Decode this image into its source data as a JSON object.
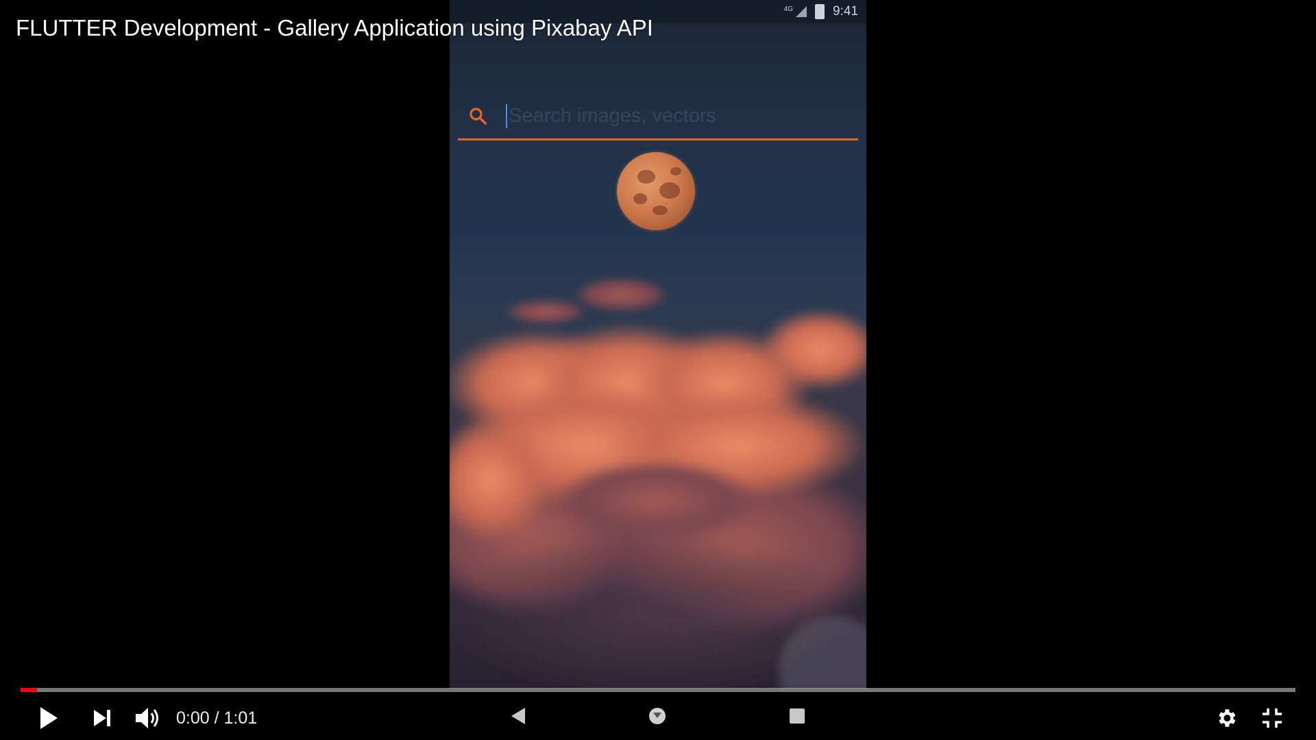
{
  "video": {
    "title": "FLUTTER Development - Gallery Application using Pixabay API"
  },
  "phone": {
    "status": {
      "network": "4G",
      "time": "9:41"
    },
    "search": {
      "placeholder": "Search images, vectors",
      "value": ""
    },
    "nav": {
      "back_icon": "back-icon",
      "home_icon": "home-icon",
      "recent_icon": "recent-apps-icon"
    }
  },
  "player": {
    "progress_fraction": 0.0,
    "time_current": "0:00",
    "time_separator": "/",
    "time_total": "1:01",
    "time_display": "0:00 / 1:01",
    "icons": {
      "play": "play-icon",
      "next": "next-icon",
      "volume": "volume-icon",
      "settings": "gear-icon",
      "fullscreen_exit": "exit-fullscreen-icon"
    }
  },
  "colors": {
    "accent": "#e0662c",
    "progress_played": "#ff0000",
    "cursor": "#4f8fd6"
  }
}
